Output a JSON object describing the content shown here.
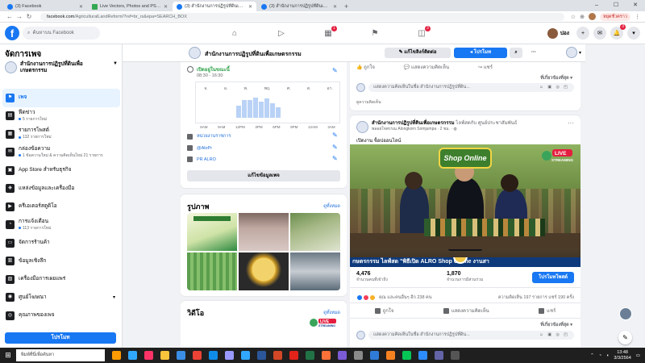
{
  "browser": {
    "tabs": [
      {
        "label": "(3) Facebook"
      },
      {
        "label": "Live Vectors, Photos and PSD files"
      },
      {
        "label": "(3) สำนักงานการปฏิรูปที่ดินเพื่อเกษตรกรรม"
      },
      {
        "label": "(3) สำนักงานการปฏิรูปที่ดินเพื่อเกษตรกรรม"
      }
    ],
    "url_host": "facebook.com",
    "url_path": "/AgriculturalLandReform/?ref=br_rs&epa=SEARCH_BOX",
    "paused_label": "หยุดชั่วคราว"
  },
  "fb": {
    "logo": "f",
    "search_placeholder": "ค้นหาบน Facebook",
    "nav_badges": {
      "groups": "1",
      "gaming": "3"
    },
    "profile_name": "ปอง",
    "notif_badge": "3"
  },
  "sidebar": {
    "title": "จัดการเพจ",
    "page_name": "สำนักงานการปฏิรูปที่ดินเพื่อเกษตรกรรม",
    "items": [
      {
        "label": "เพจ",
        "icon": "flag-icon",
        "sub": ""
      },
      {
        "label": "ฟีดข่าว",
        "icon": "news-feed-icon",
        "sub": "5 รายการใหม่"
      },
      {
        "label": "รายการโพสต์",
        "icon": "posts-icon",
        "sub": "132 รายการใหม่"
      },
      {
        "label": "กล่องข้อความ",
        "icon": "inbox-icon",
        "sub": "1 ข้อความใหม่ & ความคิดเห็นใหม่ 21 รายการ"
      },
      {
        "label": "App Store สำหรับธุรกิจ",
        "icon": "store-icon",
        "sub": ""
      },
      {
        "label": "แหล่งข้อมูลและเครื่องมือ",
        "icon": "resources-icon",
        "sub": ""
      },
      {
        "label": "ครีเอเตอร์สตูดิโอ",
        "icon": "creator-studio-icon",
        "sub": ""
      },
      {
        "label": "การแจ้งเตือน",
        "icon": "bell-icon",
        "sub": "113 รายการใหม่"
      },
      {
        "label": "จัดการร้านค้า",
        "icon": "shop-icon",
        "sub": ""
      },
      {
        "label": "ข้อมูลเชิงลึก",
        "icon": "insights-icon",
        "sub": ""
      },
      {
        "label": "เครื่องมือการเผยแพร่",
        "icon": "publishing-tools-icon",
        "sub": ""
      },
      {
        "label": "ศูนย์โฆษณา",
        "icon": "ad-center-icon",
        "sub": "",
        "chevron": true
      },
      {
        "label": "คุณภาพของเพจ",
        "icon": "page-quality-icon",
        "sub": ""
      }
    ],
    "promote_label": "โปรโมท"
  },
  "pagebar": {
    "name": "สำนักงานการปฏิรูปที่ดินเพื่อเกษตรกรรม",
    "edit_label": "แก้ไขลิงก์ติดต่อ",
    "promote_label": "โปรโมท"
  },
  "about": {
    "open_now": "เปิดอยู่ในขณะนี้",
    "hours": "08:30 - 16:30",
    "day_labels": [
      "จ.",
      "อ.",
      "พ.",
      "พฤ.",
      "ศ.",
      "ส.",
      "อา."
    ],
    "time_labels": [
      "6AM",
      "9AM",
      "12PM",
      "3PM",
      "6PM",
      "9PM",
      "12AM",
      "3AM"
    ],
    "busy_bars": [
      0.55,
      0.8,
      0.8,
      0.9,
      0.7,
      0.85,
      0.65,
      0.45
    ],
    "category": "หน่วยงานราชการ",
    "twitter": "@AloPr",
    "prname": "PR ALRO",
    "edit_info": "แก้ไขข้อมูลเพจ"
  },
  "photos": {
    "title": "รูปภาพ",
    "see_all": "ดูทั้งหมด"
  },
  "videos": {
    "title": "วิดีโอ",
    "see_all": "ดูทั้งหมด",
    "live_label": "LIVE",
    "streaming_label": "STREAMING"
  },
  "feed_top": {
    "like": "ถูกใจ",
    "comment": "แสดงความคิดเห็น",
    "share": "แชร์",
    "relevant": "ที่เกี่ยวข้องที่สุด",
    "comment_placeholder": "แสดงความคิดเห็นในชื่อ สำนักงานการปฏิรูปที่ดิน...",
    "hint": "ดูความคิดเห็น"
  },
  "post": {
    "author": "สำนักงานการปฏิรูปที่ดินเพื่อเกษตรกรรม",
    "with_text": "ไลฟ์สดกับ ศูนย์ประชาสัมพันธ์",
    "tagged": "พลอยใจพรรณ Alongkorn Somjumpa",
    "time": "2 ชม.",
    "text": "เปิดงาน ช็อปออนไลน์",
    "video": {
      "shop_title": "Shop Online",
      "live": "LIVE",
      "streaming": "STREAMING",
      "ticker": "กษตรกรรม           ไลฟ์สด  \"พิธีเปิด ALRO Shop Online งานสา"
    },
    "stats": [
      {
        "num": "4,476",
        "lbl": "จำนวนคนที่เข้าถึง"
      },
      {
        "num": "1,870",
        "lbl": "จำนวนการมีส่วนร่วม"
      }
    ],
    "boost_label": "โปรโมทโพสต์",
    "reactions_text": "คุณ และคนอื่นๆ อีก 238 คน",
    "counts_text": "ความคิดเห็น 197 รายการ  แชร์ 190 ครั้ง",
    "like": "ถูกใจ",
    "comment": "แสดงความคิดเห็น",
    "share": "แชร์",
    "relevant": "ที่เกี่ยวข้องที่สุด",
    "comment_placeholder": "แสดงความคิดเห็นในชื่อ สำนักงานการปฏิรูปที่ดิน..."
  },
  "taskbar": {
    "search_placeholder": "พิมพ์ที่นี่เพื่อค้นหา",
    "time": "13:48",
    "date": "3/3/2564",
    "apps": [
      {
        "name": "illustrator-icon",
        "color": "#ff9a00"
      },
      {
        "name": "photoshop-icon",
        "color": "#31a8ff"
      },
      {
        "name": "indesign-icon",
        "color": "#ff3366"
      },
      {
        "name": "file-explorer-icon",
        "color": "#f8c43b"
      },
      {
        "name": "store-app-icon",
        "color": "#3a8ee6"
      },
      {
        "name": "chrome-icon",
        "color": "#ea4335"
      },
      {
        "name": "edge-icon",
        "color": "#0f8ce8"
      },
      {
        "name": "premiere-icon",
        "color": "#9999ff"
      },
      {
        "name": "lightroom-icon",
        "color": "#31a8ff"
      },
      {
        "name": "word-icon",
        "color": "#2b579a"
      },
      {
        "name": "powerpoint-icon",
        "color": "#d24726"
      },
      {
        "name": "acrobat-icon",
        "color": "#e2231a"
      },
      {
        "name": "excel-icon",
        "color": "#217346"
      },
      {
        "name": "firefox-icon",
        "color": "#ff7139"
      },
      {
        "name": "media-icon",
        "color": "#7b5bd6"
      },
      {
        "name": "settings-app-icon",
        "color": "#8a8a8a"
      },
      {
        "name": "mail-icon",
        "color": "#2f7bd8"
      },
      {
        "name": "vlc-icon",
        "color": "#f58220"
      },
      {
        "name": "line-icon",
        "color": "#06c755"
      },
      {
        "name": "zoom-icon",
        "color": "#2d8cff"
      },
      {
        "name": "teams-icon",
        "color": "#6264a7"
      },
      {
        "name": "camera-icon",
        "color": "#555555"
      }
    ]
  },
  "colors": {
    "fb_blue": "#1877f2",
    "link": "#216fdb",
    "open_green": "#31a24c"
  }
}
